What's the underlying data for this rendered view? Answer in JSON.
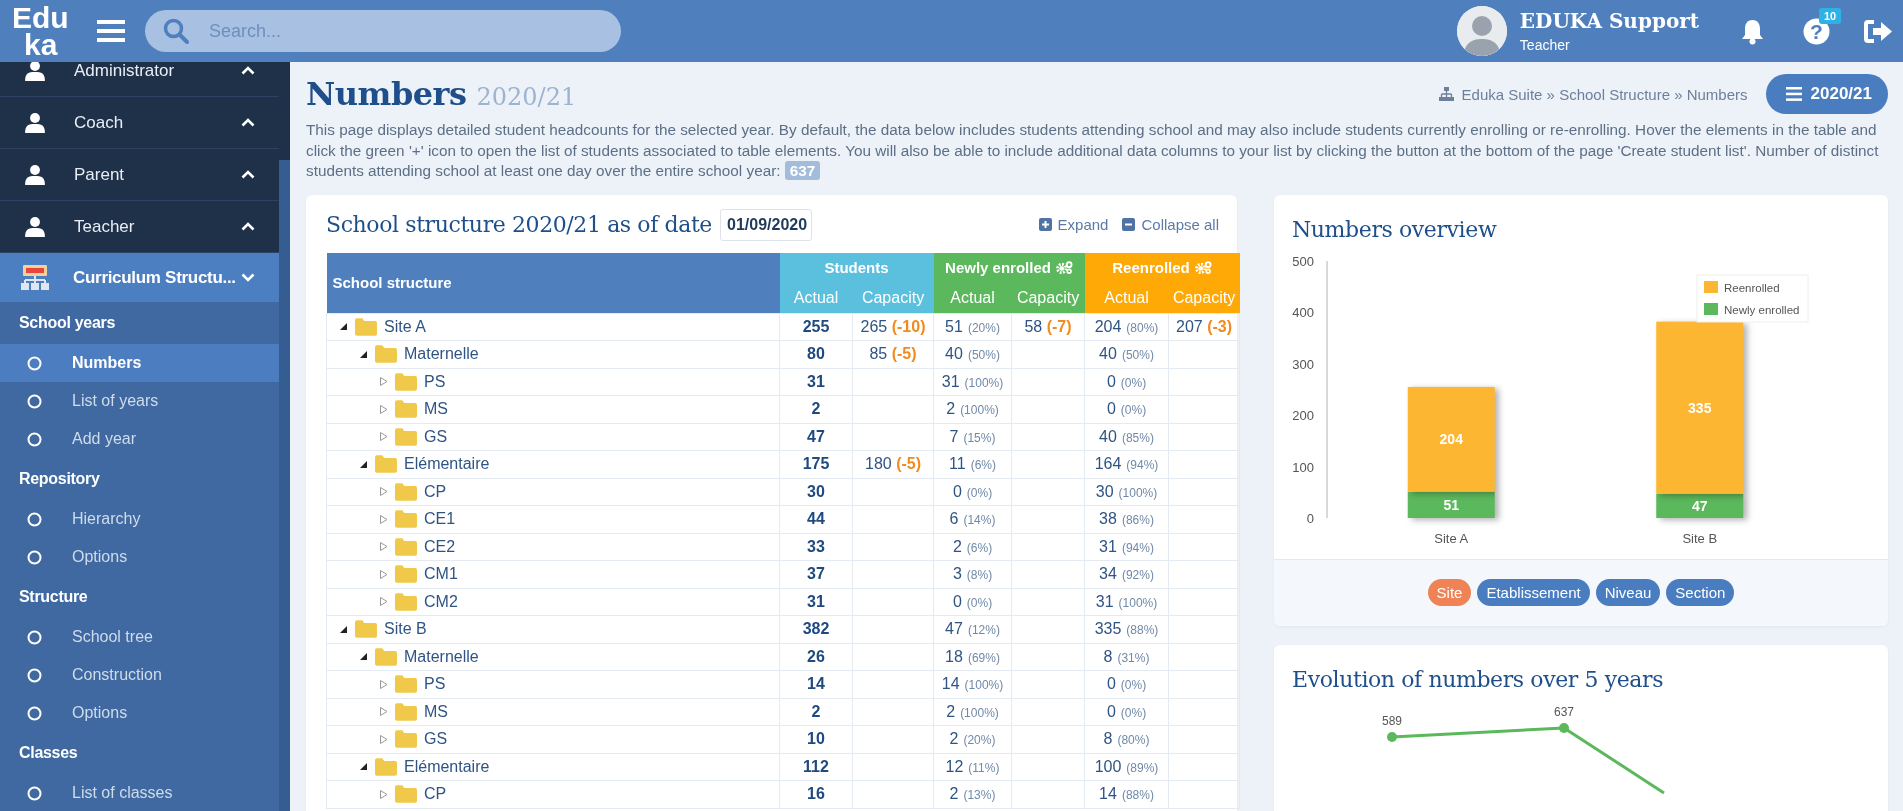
{
  "header": {
    "logo_lines": [
      "Edu",
      "ka"
    ],
    "search": {
      "placeholder": "Search..."
    },
    "user": {
      "name": "EDUKA Support",
      "role": "Teacher"
    },
    "help_glyph": "?",
    "help_badge": "10"
  },
  "sidebar": {
    "roles": [
      {
        "label": "Administrator",
        "expanded": false
      },
      {
        "label": "Coach",
        "expanded": false
      },
      {
        "label": "Parent",
        "expanded": false
      },
      {
        "label": "Teacher",
        "expanded": false
      }
    ],
    "module": {
      "label": "Curriculum Structu...",
      "expanded": true
    },
    "sections": [
      {
        "title": "School years",
        "items": [
          {
            "label": "Numbers",
            "selected": true
          },
          {
            "label": "List of years",
            "selected": false
          },
          {
            "label": "Add year",
            "selected": false
          }
        ]
      },
      {
        "title": "Repository",
        "items": [
          {
            "label": "Hierarchy",
            "selected": false
          },
          {
            "label": "Options",
            "selected": false
          }
        ]
      },
      {
        "title": "Structure",
        "items": [
          {
            "label": "School tree",
            "selected": false
          },
          {
            "label": "Construction",
            "selected": false
          },
          {
            "label": "Options",
            "selected": false
          }
        ]
      },
      {
        "title": "Classes",
        "items": [
          {
            "label": "List of classes",
            "selected": false
          }
        ]
      }
    ]
  },
  "page": {
    "title": "Numbers",
    "year": "2020/21",
    "breadcrumb": "Eduka Suite » School Structure » Numbers",
    "year_button": "2020/21",
    "description": "This page displays detailed student headcounts for the selected year. By default, the data below includes students attending school and may also include students currently enrolling or re-enrolling. Hover the elements in the table and click the green '+' icon to open the list of students associated to table elements. You will also be able to include additional data columns to your list by clicking the button at the bottom of the page 'Create student list'. Number of distinct students attending school at least one day over the entire school year:",
    "distinct_count": "637"
  },
  "structure": {
    "title": "School structure 2020/21 as of date",
    "date": "01/09/2020",
    "expand": "Expand",
    "collapse": "Collapse all",
    "tree_header": "School structure",
    "groups": [
      {
        "label": "Students",
        "color": "#5bc0de",
        "gear": false,
        "columns": [
          "Actual",
          "Capacity"
        ]
      },
      {
        "label": "Newly enrolled",
        "color": "#5cb85c",
        "gear": true,
        "columns": [
          "Actual",
          "Capacity"
        ]
      },
      {
        "label": "Reenrolled",
        "color": "#fea905",
        "gear": true,
        "columns": [
          "Actual",
          "Capacity"
        ]
      }
    ],
    "rows": [
      {
        "name": "Site A",
        "expanded": true,
        "actual": "255",
        "capacity": "265",
        "capacity_diff": "(-10)",
        "new": "51",
        "new_pct": "(20%)",
        "new_capacity": "58",
        "new_capacity_diff": "(-7)",
        "re": "204",
        "re_pct": "(80%)",
        "re_capacity": "207",
        "re_capacity_diff": "(-3)",
        "children": [
          {
            "name": "Maternelle",
            "expanded": true,
            "actual": "80",
            "capacity": "85",
            "capacity_diff": "(-5)",
            "new": "40",
            "new_pct": "(50%)",
            "re": "40",
            "re_pct": "(50%)",
            "children": [
              {
                "name": "PS",
                "expanded": false,
                "actual": "31",
                "new": "31",
                "new_pct": "(100%)",
                "re": "0",
                "re_pct": "(0%)"
              },
              {
                "name": "MS",
                "expanded": false,
                "actual": "2",
                "new": "2",
                "new_pct": "(100%)",
                "re": "0",
                "re_pct": "(0%)"
              },
              {
                "name": "GS",
                "expanded": false,
                "actual": "47",
                "new": "7",
                "new_pct": "(15%)",
                "re": "40",
                "re_pct": "(85%)"
              }
            ]
          },
          {
            "name": "Elémentaire",
            "expanded": true,
            "actual": "175",
            "capacity": "180",
            "capacity_diff": "(-5)",
            "new": "11",
            "new_pct": "(6%)",
            "re": "164",
            "re_pct": "(94%)",
            "children": [
              {
                "name": "CP",
                "expanded": false,
                "actual": "30",
                "new": "0",
                "new_pct": "(0%)",
                "re": "30",
                "re_pct": "(100%)"
              },
              {
                "name": "CE1",
                "expanded": false,
                "actual": "44",
                "new": "6",
                "new_pct": "(14%)",
                "re": "38",
                "re_pct": "(86%)"
              },
              {
                "name": "CE2",
                "expanded": false,
                "actual": "33",
                "new": "2",
                "new_pct": "(6%)",
                "re": "31",
                "re_pct": "(94%)"
              },
              {
                "name": "CM1",
                "expanded": false,
                "actual": "37",
                "new": "3",
                "new_pct": "(8%)",
                "re": "34",
                "re_pct": "(92%)"
              },
              {
                "name": "CM2",
                "expanded": false,
                "actual": "31",
                "new": "0",
                "new_pct": "(0%)",
                "re": "31",
                "re_pct": "(100%)"
              }
            ]
          }
        ]
      },
      {
        "name": "Site B",
        "expanded": true,
        "actual": "382",
        "new": "47",
        "new_pct": "(12%)",
        "re": "335",
        "re_pct": "(88%)",
        "children": [
          {
            "name": "Maternelle",
            "expanded": true,
            "actual": "26",
            "new": "18",
            "new_pct": "(69%)",
            "re": "8",
            "re_pct": "(31%)",
            "children": [
              {
                "name": "PS",
                "expanded": false,
                "actual": "14",
                "new": "14",
                "new_pct": "(100%)",
                "re": "0",
                "re_pct": "(0%)"
              },
              {
                "name": "MS",
                "expanded": false,
                "actual": "2",
                "new": "2",
                "new_pct": "(100%)",
                "re": "0",
                "re_pct": "(0%)"
              },
              {
                "name": "GS",
                "expanded": false,
                "actual": "10",
                "new": "2",
                "new_pct": "(20%)",
                "re": "8",
                "re_pct": "(80%)"
              }
            ]
          },
          {
            "name": "Elémentaire",
            "expanded": true,
            "actual": "112",
            "new": "12",
            "new_pct": "(11%)",
            "re": "100",
            "re_pct": "(89%)",
            "children": [
              {
                "name": "CP",
                "expanded": false,
                "actual": "16",
                "new": "2",
                "new_pct": "(13%)",
                "re": "14",
                "re_pct": "(88%)"
              }
            ]
          }
        ]
      }
    ]
  },
  "numbers_overview": {
    "title": "Numbers overview",
    "chart_data": {
      "type": "bar",
      "stacked": true,
      "categories": [
        "Site A",
        "Site B"
      ],
      "series": [
        {
          "name": "Newly enrolled",
          "color": "#5cb85c",
          "values": [
            51,
            47
          ]
        },
        {
          "name": "Reenrolled",
          "color": "#fdb631",
          "values": [
            204,
            335
          ]
        }
      ],
      "ylim": [
        0,
        500
      ],
      "yticks": [
        0,
        100,
        200,
        300,
        400,
        500
      ],
      "data_labels": true,
      "legend": "upper right"
    },
    "chips": [
      {
        "label": "Site",
        "selected": true
      },
      {
        "label": "Etablissement",
        "selected": false
      },
      {
        "label": "Niveau",
        "selected": false
      },
      {
        "label": "Section",
        "selected": false
      }
    ]
  },
  "evolution": {
    "title": "Evolution of numbers over 5 years",
    "chart_data": {
      "type": "line",
      "categories": [
        null,
        null
      ],
      "series": [
        {
          "color": "#5cb85c",
          "marker": "circle",
          "values": [
            589,
            637
          ]
        }
      ],
      "data_labels": true
    }
  }
}
